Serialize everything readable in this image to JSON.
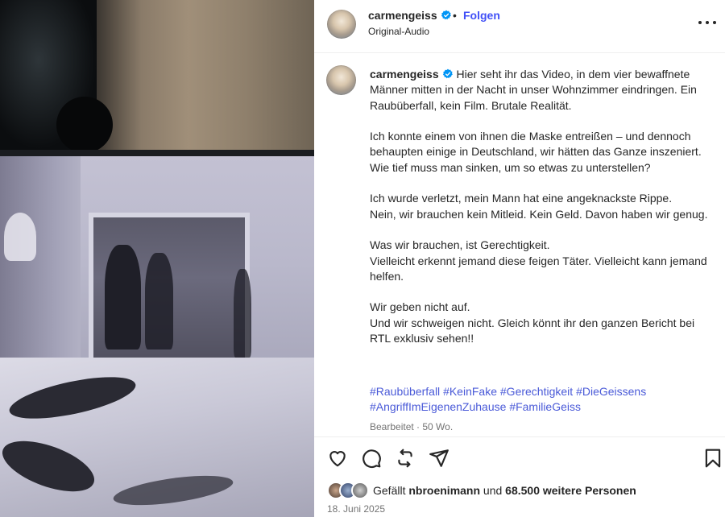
{
  "post": {
    "username": "carmengeiss",
    "separator": "•",
    "follow_label": "Folgen",
    "audio_label": "Original-Audio",
    "more_icon": "more-horizontal-icon",
    "verified_color": "#0095f6",
    "link_color": "#4150f7",
    "caption": {
      "username": "carmengeiss",
      "text": "Hier seht ihr das Video, in dem vier bewaffnete Männer mitten in der Nacht in unser Wohnzimmer eindringen. Ein Raubüberfall, kein Film. Brutale Realität.\n\nIch konnte einem von ihnen die Maske entreißen – und dennoch behaupten einige in Deutschland, wir hätten das Ganze inszeniert.\nWie tief muss man sinken, um so etwas zu unterstellen?\n\nIch wurde verletzt, mein Mann hat eine angeknackste Rippe.\nNein, wir brauchen kein Mitleid. Kein Geld. Davon haben wir genug.\n\nWas wir brauchen, ist Gerechtigkeit.\nVielleicht erkennt jemand diese feigen Täter. Vielleicht kann jemand helfen.\n\nWir geben nicht auf.\nUnd wir schweigen nicht. Gleich könnt ihr den ganzen Bericht bei RTL exklusiv sehen!!",
      "hashtags": [
        "#Raubüberfall",
        "#KeinFake",
        "#Gerechtigkeit",
        "#DieGeissens",
        "#AngriffImEigenenZuhause",
        "#FamilieGeiss"
      ],
      "meta": "Bearbeitet · 50 Wo."
    },
    "actions": {
      "like_icon": "heart-icon",
      "comment_icon": "comment-icon",
      "share_icon": "repost-icon",
      "send_icon": "send-icon",
      "save_icon": "bookmark-icon"
    },
    "likes": {
      "prefix": "Gefällt",
      "user": "nbroenimann",
      "middle": "und",
      "count_text": "68.500 weitere Personen"
    },
    "date": "18. Juni 2025"
  }
}
